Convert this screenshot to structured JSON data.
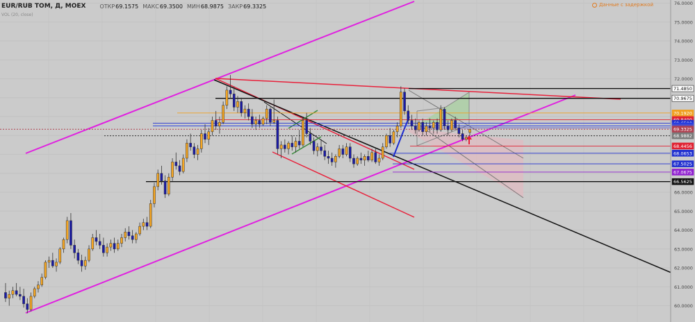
{
  "header": {
    "symbol": "EUR/RUB TOM, Д, MOEX",
    "open_label": "ОТКР",
    "open": "69.1575",
    "high_label": "МАКС",
    "high": "69.3500",
    "low_label": "МИН",
    "low": "68.9875",
    "close_label": "ЗАКР",
    "close": "69.3325",
    "sub_indicator": "VOL (20, close)"
  },
  "delay_notice": "Данные с задержкой",
  "colors": {
    "background": "#cbcbcb",
    "candle_up": "#f5a623",
    "candle_down": "#1a1aa6",
    "channel": "#e020e0",
    "trend_red": "#e8203a",
    "trend_black": "#111111"
  },
  "chart_data": {
    "type": "candlestick",
    "y_axis_ticks": [
      "76.0000",
      "75.0000",
      "74.0000",
      "73.0000",
      "72.0000",
      "71.0000",
      "70.0000",
      "69.0000",
      "68.0000",
      "67.0000",
      "66.0000",
      "65.0000",
      "64.0000",
      "63.0000",
      "62.0000",
      "61.0000",
      "60.0000"
    ],
    "ylim": [
      59.6,
      76.2
    ],
    "price_labels": [
      {
        "value": "71.4850",
        "num": 71.485,
        "bg": "#ffffff",
        "fg": "#111111",
        "line": "#111111"
      },
      {
        "value": "70.9675",
        "num": 70.9675,
        "bg": "#ffffff",
        "fg": "#111111",
        "line": "#111111"
      },
      {
        "value": "70.1920",
        "num": 70.192,
        "bg": "#f0a020",
        "fg": "#ffffff",
        "line": "#f0a020"
      },
      {
        "value": "69.8400",
        "num": 69.84,
        "bg": "#e02030",
        "fg": "#ffffff",
        "line": "#e02030"
      },
      {
        "value": "69.6500",
        "num": 69.65,
        "bg": "#2030d0",
        "fg": "#ffffff",
        "line": "#2030d0"
      },
      {
        "value": "69.5110",
        "num": 69.511,
        "bg": "#2a40e0",
        "fg": "#ffffff",
        "line": "#2a40e0"
      },
      {
        "value": "69.4092",
        "num": 69.4092,
        "bg": "#5050c8",
        "fg": "#ffffff",
        "line": "#5050c8"
      },
      {
        "value": "69.3325",
        "num": 69.3325,
        "bg": "#b04050",
        "fg": "#ffffff",
        "line": "#b04050"
      },
      {
        "value": "68.9882",
        "num": 68.9882,
        "bg": "#7a7a7a",
        "fg": "#ffffff",
        "line": "#333333"
      },
      {
        "value": "68.4456",
        "num": 68.4456,
        "bg": "#e02030",
        "fg": "#ffffff",
        "line": "#e02030"
      },
      {
        "value": "68.0653",
        "num": 68.0653,
        "bg": "#2030d0",
        "fg": "#ffffff",
        "line": "#2030d0"
      },
      {
        "value": "67.5025",
        "num": 67.5025,
        "bg": "#2030d0",
        "fg": "#ffffff",
        "line": "#2030d0"
      },
      {
        "value": "67.0675",
        "num": 67.0675,
        "bg": "#9020d0",
        "fg": "#ffffff",
        "line": "#9020d0"
      },
      {
        "value": "66.5625",
        "num": 66.5625,
        "bg": "#111111",
        "fg": "#ffffff",
        "line": "#111111"
      }
    ],
    "candles": [
      [
        60.7,
        61.2,
        60.2,
        60.4
      ],
      [
        60.4,
        60.8,
        60.0,
        60.6
      ],
      [
        60.6,
        61.0,
        60.4,
        60.8
      ],
      [
        60.8,
        61.2,
        60.5,
        60.6
      ],
      [
        60.6,
        61.0,
        60.3,
        60.5
      ],
      [
        60.5,
        60.9,
        59.9,
        60.1
      ],
      [
        60.1,
        60.4,
        59.6,
        59.8
      ],
      [
        59.8,
        60.7,
        59.7,
        60.5
      ],
      [
        60.5,
        61.0,
        60.4,
        60.9
      ],
      [
        60.9,
        61.3,
        60.7,
        61.1
      ],
      [
        61.1,
        61.7,
        61.0,
        61.5
      ],
      [
        61.5,
        62.4,
        61.4,
        62.3
      ],
      [
        62.3,
        62.6,
        62.0,
        62.4
      ],
      [
        62.4,
        62.8,
        62.0,
        62.1
      ],
      [
        62.1,
        62.5,
        61.8,
        62.3
      ],
      [
        62.3,
        63.1,
        62.2,
        63.0
      ],
      [
        63.0,
        63.6,
        62.8,
        63.5
      ],
      [
        63.5,
        64.7,
        63.3,
        64.5
      ],
      [
        64.5,
        64.9,
        63.0,
        63.2
      ],
      [
        63.2,
        63.5,
        62.5,
        62.8
      ],
      [
        62.8,
        63.0,
        62.2,
        62.4
      ],
      [
        62.4,
        62.7,
        61.8,
        62.1
      ],
      [
        62.1,
        62.6,
        61.9,
        62.4
      ],
      [
        62.4,
        63.2,
        62.3,
        63.0
      ],
      [
        63.0,
        63.8,
        62.9,
        63.6
      ],
      [
        63.6,
        64.0,
        63.2,
        63.4
      ],
      [
        63.4,
        63.8,
        63.0,
        63.2
      ],
      [
        63.2,
        63.6,
        62.6,
        62.8
      ],
      [
        62.8,
        63.3,
        62.6,
        63.1
      ],
      [
        63.1,
        63.5,
        62.9,
        63.3
      ],
      [
        63.3,
        63.6,
        62.8,
        63.0
      ],
      [
        63.0,
        63.5,
        62.9,
        63.3
      ],
      [
        63.3,
        63.8,
        63.1,
        63.6
      ],
      [
        63.6,
        64.1,
        63.4,
        63.9
      ],
      [
        63.9,
        64.2,
        63.5,
        63.7
      ],
      [
        63.7,
        64.0,
        63.3,
        63.5
      ],
      [
        63.5,
        63.9,
        63.3,
        63.8
      ],
      [
        63.8,
        64.4,
        63.7,
        64.2
      ],
      [
        64.2,
        64.6,
        64.0,
        64.4
      ],
      [
        64.4,
        64.7,
        64.0,
        64.2
      ],
      [
        64.2,
        65.6,
        64.1,
        65.4
      ],
      [
        65.4,
        66.5,
        65.2,
        66.3
      ],
      [
        66.3,
        67.2,
        66.1,
        67.0
      ],
      [
        67.0,
        67.4,
        66.4,
        66.6
      ],
      [
        66.6,
        66.9,
        65.7,
        65.9
      ],
      [
        65.9,
        67.0,
        65.8,
        66.8
      ],
      [
        66.8,
        67.8,
        66.6,
        67.6
      ],
      [
        67.6,
        68.1,
        67.2,
        67.4
      ],
      [
        67.4,
        67.7,
        66.9,
        67.1
      ],
      [
        67.1,
        68.0,
        67.0,
        67.8
      ],
      [
        67.8,
        68.8,
        67.6,
        68.6
      ],
      [
        68.6,
        69.1,
        68.2,
        68.4
      ],
      [
        68.4,
        68.6,
        67.8,
        68.0
      ],
      [
        68.0,
        68.5,
        67.7,
        68.3
      ],
      [
        68.3,
        69.3,
        68.1,
        69.1
      ],
      [
        69.1,
        69.6,
        68.6,
        68.8
      ],
      [
        68.8,
        69.4,
        68.5,
        69.2
      ],
      [
        69.2,
        70.0,
        69.0,
        69.8
      ],
      [
        69.8,
        70.3,
        69.3,
        69.5
      ],
      [
        69.5,
        70.0,
        69.1,
        69.7
      ],
      [
        69.7,
        70.8,
        69.6,
        70.6
      ],
      [
        70.6,
        71.6,
        70.4,
        71.4
      ],
      [
        71.4,
        72.2,
        71.0,
        71.2
      ],
      [
        71.2,
        71.6,
        70.3,
        70.5
      ],
      [
        70.5,
        71.1,
        70.2,
        70.8
      ],
      [
        70.8,
        71.0,
        70.0,
        70.2
      ],
      [
        70.2,
        70.6,
        69.9,
        70.4
      ],
      [
        70.4,
        70.7,
        69.8,
        70.0
      ],
      [
        70.0,
        70.4,
        69.4,
        69.6
      ],
      [
        69.6,
        70.0,
        69.3,
        69.8
      ],
      [
        69.8,
        70.1,
        69.4,
        69.6
      ],
      [
        69.6,
        70.0,
        69.5,
        69.9
      ],
      [
        69.9,
        70.6,
        69.6,
        70.4
      ],
      [
        70.4,
        70.5,
        69.5,
        69.7
      ],
      [
        69.7,
        70.9,
        69.6,
        69.8
      ],
      [
        69.8,
        70.0,
        68.0,
        68.3
      ],
      [
        68.3,
        68.7,
        67.8,
        68.5
      ],
      [
        68.5,
        68.8,
        68.1,
        68.3
      ],
      [
        68.3,
        68.7,
        68.0,
        68.6
      ],
      [
        68.6,
        69.0,
        68.2,
        68.4
      ],
      [
        68.4,
        68.9,
        68.1,
        68.7
      ],
      [
        68.7,
        69.3,
        68.3,
        68.5
      ],
      [
        68.5,
        70.0,
        68.4,
        69.8
      ],
      [
        69.8,
        70.2,
        68.9,
        69.1
      ],
      [
        69.1,
        69.4,
        68.5,
        68.7
      ],
      [
        68.7,
        68.9,
        68.0,
        68.2
      ],
      [
        68.2,
        68.6,
        67.9,
        68.4
      ],
      [
        68.4,
        68.8,
        68.0,
        68.2
      ],
      [
        68.2,
        68.5,
        67.7,
        67.9
      ],
      [
        67.9,
        68.2,
        67.5,
        67.8
      ],
      [
        67.8,
        68.1,
        67.4,
        67.6
      ],
      [
        67.6,
        68.0,
        67.3,
        67.9
      ],
      [
        67.9,
        68.5,
        67.8,
        68.3
      ],
      [
        68.3,
        68.5,
        67.8,
        68.0
      ],
      [
        68.0,
        68.6,
        67.9,
        68.4
      ],
      [
        68.4,
        68.6,
        67.6,
        67.8
      ],
      [
        67.8,
        68.0,
        67.3,
        67.5
      ],
      [
        67.5,
        67.9,
        67.4,
        67.8
      ],
      [
        67.8,
        68.1,
        67.5,
        67.7
      ],
      [
        67.7,
        68.0,
        67.4,
        67.9
      ],
      [
        67.9,
        68.2,
        67.6,
        67.7
      ],
      [
        67.7,
        68.3,
        67.6,
        68.1
      ],
      [
        68.1,
        68.3,
        67.5,
        67.6
      ],
      [
        67.6,
        68.0,
        67.4,
        67.8
      ],
      [
        67.8,
        68.6,
        67.7,
        68.4
      ],
      [
        68.4,
        69.1,
        68.3,
        69.0
      ],
      [
        69.0,
        69.4,
        68.4,
        68.6
      ],
      [
        68.6,
        69.3,
        68.5,
        69.2
      ],
      [
        69.2,
        69.7,
        68.9,
        69.5
      ],
      [
        69.5,
        71.6,
        69.4,
        71.3
      ],
      [
        71.3,
        71.5,
        70.1,
        70.3
      ],
      [
        70.3,
        70.6,
        69.6,
        69.8
      ],
      [
        69.8,
        70.1,
        69.3,
        69.5
      ],
      [
        69.5,
        69.9,
        69.1,
        69.3
      ],
      [
        69.3,
        69.8,
        69.2,
        69.7
      ],
      [
        69.7,
        69.9,
        69.0,
        69.2
      ],
      [
        69.2,
        69.7,
        69.0,
        69.5
      ],
      [
        69.5,
        69.9,
        69.2,
        69.4
      ],
      [
        69.4,
        69.8,
        69.1,
        69.7
      ],
      [
        69.7,
        69.9,
        69.1,
        69.3
      ],
      [
        69.3,
        70.6,
        69.2,
        70.4
      ],
      [
        70.4,
        70.5,
        69.3,
        69.5
      ],
      [
        69.5,
        69.8,
        69.0,
        69.3
      ],
      [
        69.3,
        69.9,
        69.2,
        69.8
      ],
      [
        69.8,
        70.0,
        69.3,
        69.4
      ],
      [
        69.4,
        69.6,
        68.9,
        69.1
      ],
      [
        69.1,
        69.3,
        68.7,
        68.8
      ],
      [
        68.8,
        69.0,
        68.7,
        68.9
      ],
      [
        69.16,
        69.35,
        68.99,
        69.33
      ]
    ]
  }
}
